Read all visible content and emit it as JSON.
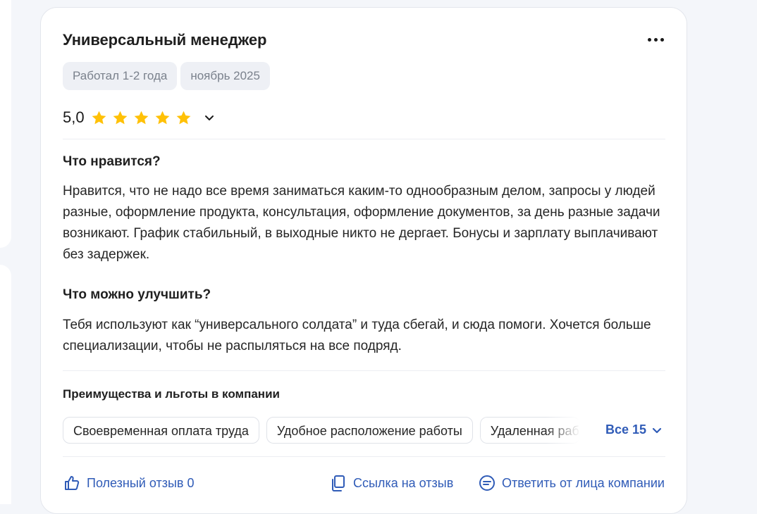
{
  "review": {
    "title": "Универсальный менеджер",
    "tags": [
      "Работал 1-2 года",
      "ноябрь 2025"
    ],
    "rating": "5,0",
    "stars_filled": 5,
    "stars_total": 5,
    "star_color": "#ffc107",
    "likes": {
      "heading": "Что нравится?",
      "text": "Нравится, что не надо все время заниматься каким-то однообразным делом, запросы у людей разные, оформление продукта, консультация, оформление документов, за день разные задачи возникают. График стабильный, в выходные никто не дергает. Бонусы и зарплату выплачивают без задержек."
    },
    "improve": {
      "heading": "Что можно улучшить?",
      "text": "Тебя используют как “универсального солдата” и туда сбегай, и сюда помоги. Хочется больше специализации, чтобы не распыляться на все подряд."
    }
  },
  "benefits": {
    "heading": "Преимущества и льготы в компании",
    "chips": [
      "Своевременная оплата труда",
      "Удобное расположение работы",
      "Удаленная работа"
    ],
    "all_label": "Все 15"
  },
  "footer": {
    "helpful": "Полезный отзыв 0",
    "link": "Ссылка на отзыв",
    "reply": "Ответить от лица компании"
  },
  "colors": {
    "accent": "#2f5bb7",
    "tag_bg": "#eef0f5"
  }
}
